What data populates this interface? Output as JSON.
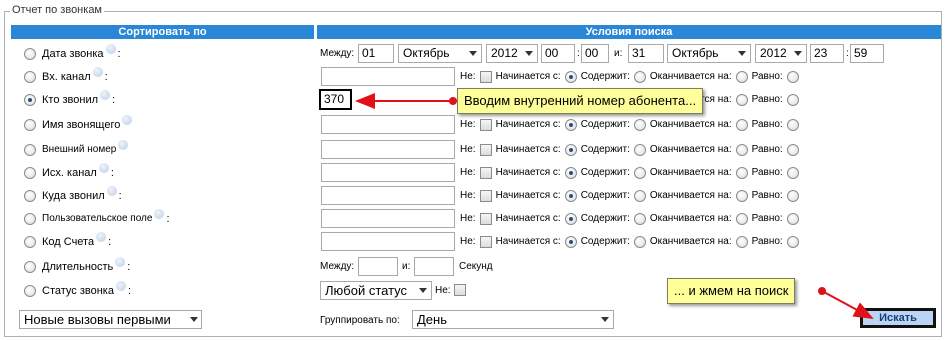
{
  "legend": "Отчет по звонкам",
  "headers": {
    "sort": "Сортировать по",
    "conditions": "Условия поиска"
  },
  "sort_options": [
    {
      "label": "Дата звонка",
      "checked": false
    },
    {
      "label": "Вх. канал",
      "checked": false
    },
    {
      "label": "Кто звонил",
      "checked": true
    },
    {
      "label": "Имя звонящего",
      "checked": false
    },
    {
      "label": "Внешний номер",
      "checked": false
    },
    {
      "label": "Исх. канал",
      "checked": false
    },
    {
      "label": "Куда звонил",
      "checked": false
    },
    {
      "label": "Пользовательское поле",
      "checked": false
    },
    {
      "label": "Код Счета",
      "checked": false
    },
    {
      "label": "Длительность",
      "checked": false
    },
    {
      "label": "Статус звонка",
      "checked": false
    }
  ],
  "date_range": {
    "between_label": "Между:",
    "and_label": "и:",
    "from": {
      "day": "01",
      "month": "Октябрь",
      "year": "2012",
      "hour": "00",
      "minute": "00"
    },
    "to": {
      "day": "31",
      "month": "Октябрь",
      "year": "2012",
      "hour": "23",
      "minute": "59"
    }
  },
  "text_filters": {
    "not_label": "Не:",
    "starts_label": "Начинается с:",
    "contains_label": "Содержит:",
    "ends_label": "Оканчивается на:",
    "equals_label": "Равно:",
    "rows": [
      {
        "value": ""
      },
      {
        "value": "370"
      },
      {
        "value": ""
      },
      {
        "value": ""
      },
      {
        "value": ""
      },
      {
        "value": ""
      },
      {
        "value": ""
      },
      {
        "value": ""
      }
    ]
  },
  "duration": {
    "between_label": "Между:",
    "and_label": "и:",
    "from": "",
    "to": "",
    "unit": "Секунд"
  },
  "status": {
    "selected": "Любой статус",
    "not_label": "Не:"
  },
  "order": {
    "selected": "Новые вызовы первыми"
  },
  "group_by": {
    "label": "Группировать по:",
    "selected": "День"
  },
  "search_button": "Искать",
  "callouts": {
    "enter_number": "Вводим внутренний номер абонента...",
    "press_search": "... и жмем на поиск"
  },
  "colors": {
    "header_bg": "#2a86d6",
    "callout_bg": "#ffff9a",
    "arrow": "#e0111b",
    "button_bg": "#bcd4f3"
  }
}
